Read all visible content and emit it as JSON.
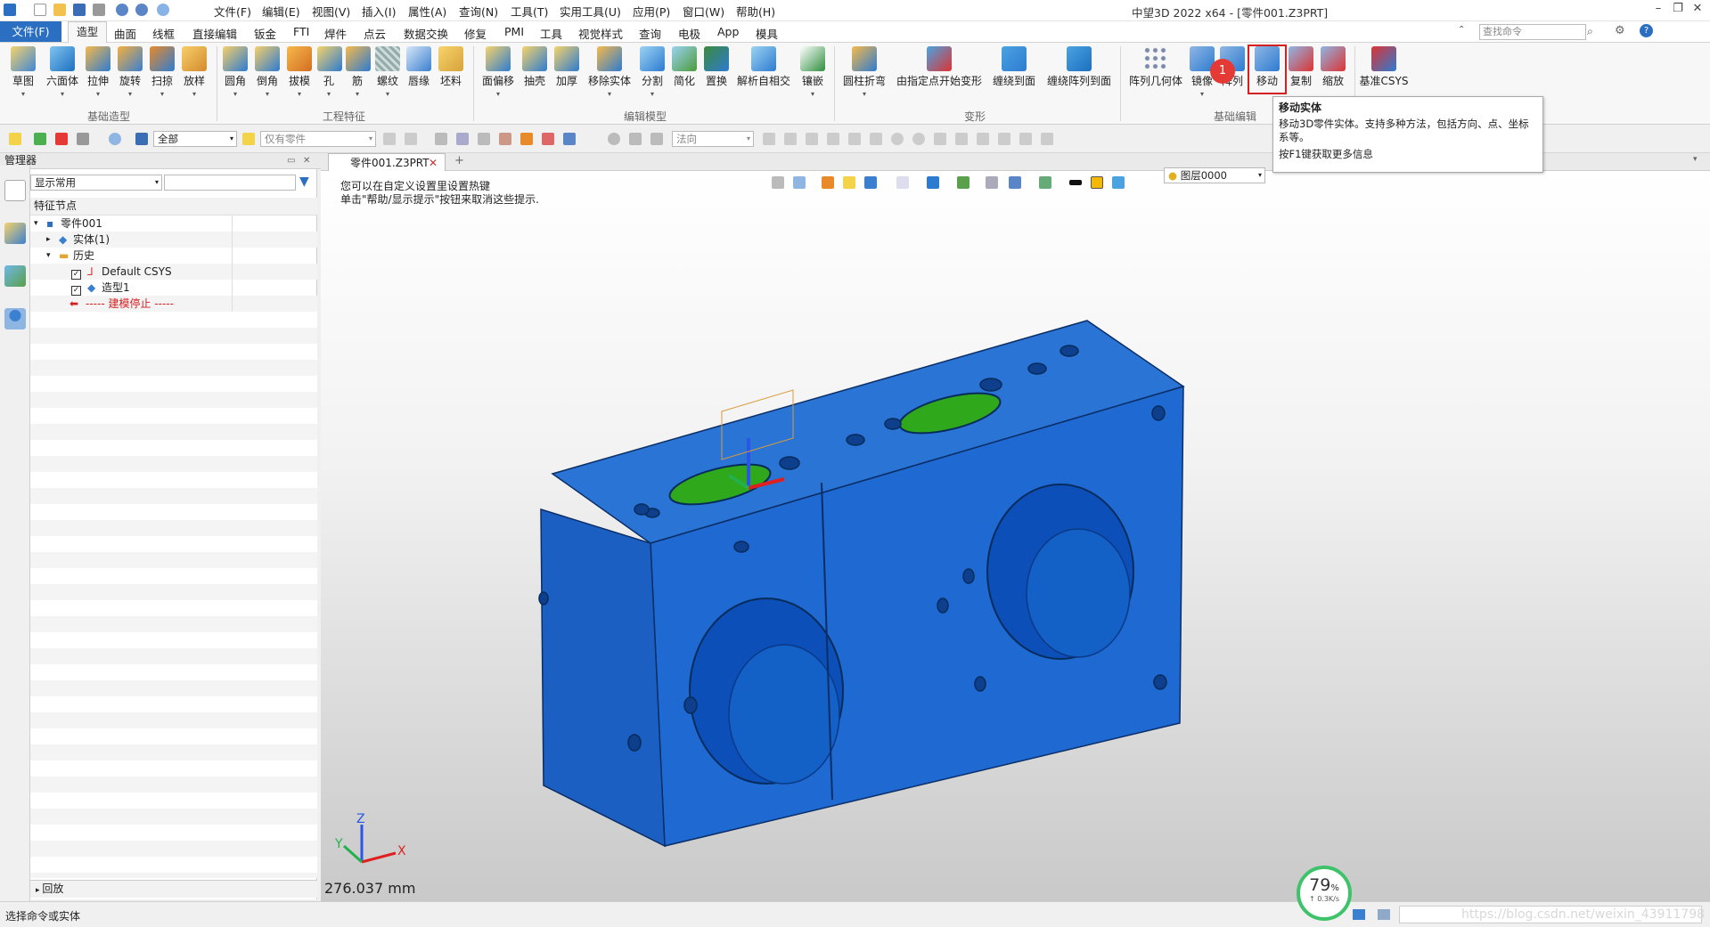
{
  "titlebar": {
    "menus": [
      "文件(F)",
      "编辑(E)",
      "视图(V)",
      "插入(I)",
      "属性(A)",
      "查询(N)",
      "工具(T)",
      "实用工具(U)",
      "应用(P)",
      "窗口(W)",
      "帮助(H)"
    ],
    "title": "中望3D 2022 x64 - [零件001.Z3PRT]"
  },
  "tabs": {
    "file": "文件(F)",
    "items": [
      "造型",
      "曲面",
      "线框",
      "直接编辑",
      "钣金",
      "FTI",
      "焊件",
      "点云",
      "数据交换",
      "修复",
      "PMI",
      "工具",
      "视觉样式",
      "查询",
      "电极",
      "App",
      "模具"
    ],
    "search_placeholder": "查找命令"
  },
  "ribbon": {
    "groups": [
      "基础造型",
      "工程特征",
      "编辑模型",
      "变形",
      "基础编辑"
    ],
    "tools": [
      "草图",
      "六面体",
      "拉伸",
      "旋转",
      "扫掠",
      "放样",
      "圆角",
      "倒角",
      "拔模",
      "孔",
      "筋",
      "螺纹",
      "唇缘",
      "坯料",
      "面偏移",
      "抽壳",
      "加厚",
      "移除实体",
      "分割",
      "简化",
      "置换",
      "解析自相交",
      "镶嵌",
      "圆柱折弯",
      "由指定点开始变形",
      "缠绕到面",
      "缠绕阵列到面",
      "阵列几何体",
      "镜像",
      "阵列",
      "移动",
      "复制",
      "缩放",
      "基准CSYS"
    ]
  },
  "toolbar2": {
    "filter": "全部",
    "filter2": "仅有零件",
    "filter3": "法向"
  },
  "manager": {
    "title": "管理器",
    "display": "显示常用",
    "column": "特征节点",
    "tree": [
      "零件001",
      "实体(1)",
      "历史",
      "Default CSYS",
      "造型1",
      "----- 建模停止 -----"
    ],
    "playback": "回放"
  },
  "viewport": {
    "tab": "零件001.Z3PRT",
    "hint1": "您可以在自定义设置里设置热键",
    "hint2": "单击\"帮助/显示提示\"按钮来取消这些提示.",
    "layer": "图层0000",
    "measure": "276.037 mm",
    "axes": {
      "x": "X",
      "y": "Y",
      "z": "Z"
    }
  },
  "tooltip": {
    "title": "移动实体",
    "body": "移动3D零件实体。支持多种方法，包括方向、点、坐标系等。",
    "help": "按F1键获取更多信息"
  },
  "badge": "1",
  "gauge": {
    "pct": "79",
    "unit": "%",
    "speed": "↑ 0.3K/s"
  },
  "status": {
    "text": "选择命令或实体",
    "watermark": "https://blog.csdn.net/weixin_43911798"
  }
}
